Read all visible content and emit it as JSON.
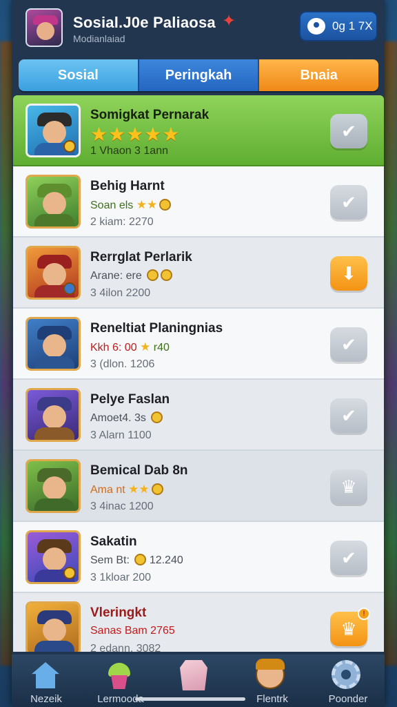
{
  "header": {
    "title": "Sosial.J0e Paliaosa",
    "subtitle": "Modianlaiad",
    "chat_button_label": "0g 1 7X"
  },
  "tabs": [
    {
      "label": "Sosial"
    },
    {
      "label": "Peringkah"
    },
    {
      "label": "Bnaia"
    }
  ],
  "list": [
    {
      "name": "Somigkat Pernarak",
      "rating": "★★★★★",
      "sub": "1 Vhaon 3 1ann",
      "action_icon": "check-badge-icon",
      "highlight": true
    },
    {
      "name": "Behig Harnt",
      "info": "Soan els",
      "stars": "★★",
      "sub": "2 kiam: 2270",
      "action_icon": "check-badge-icon"
    },
    {
      "name": "Rerrglat Perlarik",
      "info": "Arane: ere",
      "stars": "",
      "sub": "3 4ilon 2200",
      "action_icon": "arrow-down-icon"
    },
    {
      "name": "Reneltiat Planingnias",
      "info": "Kkh 6: 00",
      "stars": "★",
      "info_tail": "r40",
      "sub": "3 (dlon. 1206",
      "action_icon": "check-badge-icon"
    },
    {
      "name": "Pelye Faslan",
      "info": "Amoet4. 3s",
      "stars": "",
      "sub": "3 Alarn 1100",
      "action_icon": "check-badge-icon"
    },
    {
      "name": "Bemical Dab 8n",
      "info": "Ama nt",
      "stars": "★★",
      "sub": "3 4inac 1200",
      "action_icon": "crown-badge-icon"
    },
    {
      "name": "Sakatin",
      "info": "Sem Bt:",
      "info_tail": "12.240",
      "sub": "3 1kloar 200",
      "action_icon": "check-badge-icon"
    },
    {
      "name": "Vleringkt",
      "info": "Sanas Bam 2765",
      "sub": "2 edann. 3082",
      "action_icon": "crown-badge-icon"
    }
  ],
  "bottom_nav": [
    {
      "label": "Nezeik",
      "icon": "home-icon"
    },
    {
      "label": "Lermooda",
      "icon": "cupcake-icon"
    },
    {
      "label": "",
      "icon": "gem-icon"
    },
    {
      "label": "Flentrk",
      "icon": "hero-icon"
    },
    {
      "label": "Poonder",
      "icon": "gear-icon"
    }
  ],
  "colors": {
    "panel": "#22364f",
    "tab_sosial": "#3aa0e0",
    "tab_peringkah": "#2466c0",
    "tab_bnaia": "#ef8a18",
    "highlight_row": "#5fae32",
    "orange_action": "#f39314"
  }
}
